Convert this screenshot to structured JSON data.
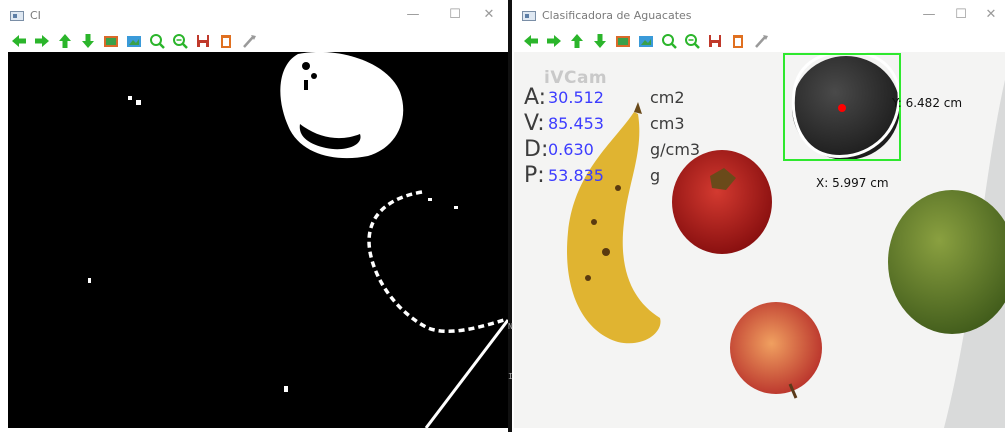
{
  "left_window": {
    "title": "CI",
    "controls": {
      "minimize": "—",
      "maximize": "☐",
      "close": "✕"
    },
    "toolbar": [
      "pan-left-icon",
      "pan-right-icon",
      "pan-up-icon",
      "pan-down-icon",
      "image-icon",
      "picture-icon",
      "zoom-in-icon",
      "zoom-out-icon",
      "save-icon",
      "copy-icon",
      "properties-icon"
    ]
  },
  "right_window": {
    "title": "Clasificadora de Aguacates",
    "controls": {
      "minimize": "—",
      "maximize": "☐",
      "close": "✕"
    },
    "toolbar": [
      "pan-left-icon",
      "pan-right-icon",
      "pan-up-icon",
      "pan-down-icon",
      "image-icon",
      "picture-icon",
      "zoom-in-icon",
      "zoom-out-icon",
      "save-icon",
      "copy-icon",
      "properties-icon"
    ],
    "overlay": {
      "watermark": "iVCam",
      "measurements": [
        {
          "label": "A:",
          "value": "30.512",
          "unit": "cm2"
        },
        {
          "label": "V:",
          "value": "85.453",
          "unit": "cm3"
        },
        {
          "label": "D:",
          "value": "0.630",
          "unit": "g/cm3"
        },
        {
          "label": "P:",
          "value": "53.835",
          "unit": "g"
        }
      ],
      "y_dimension": "Y: 6.482 cm",
      "x_dimension": "X: 5.997 cm"
    }
  },
  "colors": {
    "toolbar_arrow": "#2bb52b",
    "detect_box": "#2ee82e",
    "value_text": "#3c3cff",
    "center_dot": "#ff0000"
  }
}
